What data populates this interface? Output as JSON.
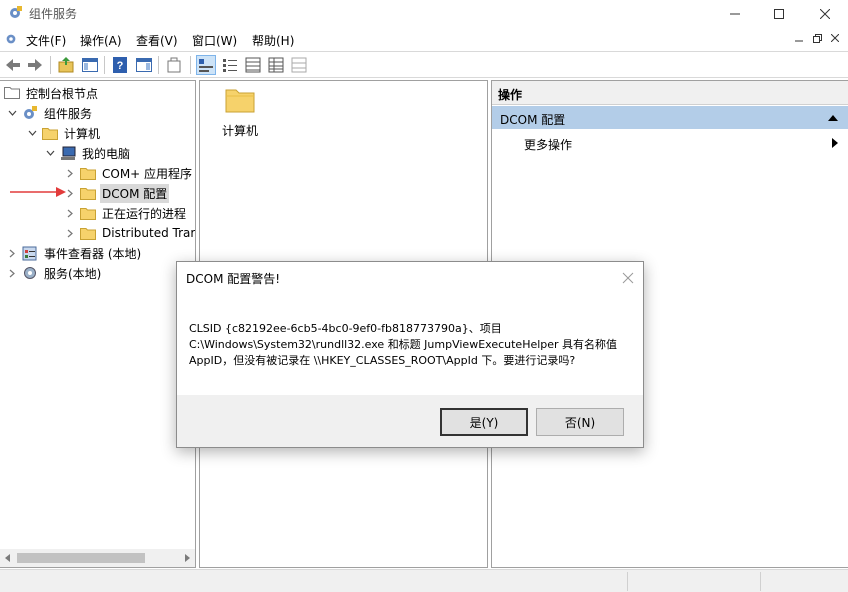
{
  "window": {
    "title": "组件服务",
    "app_icon": "component-services-icon"
  },
  "menu": [
    "文件(F)",
    "操作(A)",
    "查看(V)",
    "窗口(W)",
    "帮助(H)"
  ],
  "tree": {
    "items": [
      {
        "label": "控制台根节点",
        "icon": "folder-icon"
      },
      {
        "label": "组件服务",
        "icon": "component-services-icon"
      },
      {
        "label": "计算机",
        "icon": "folder-icon"
      },
      {
        "label": "我的电脑",
        "icon": "computer-icon"
      },
      {
        "label": "COM+ 应用程序",
        "icon": "folder-icon"
      },
      {
        "label": "DCOM 配置",
        "icon": "folder-icon"
      },
      {
        "label": "正在运行的进程",
        "icon": "folder-icon"
      },
      {
        "label": "Distributed Trar",
        "icon": "folder-icon"
      },
      {
        "label": "事件查看器 (本地)",
        "icon": "event-viewer-icon"
      },
      {
        "label": "服务(本地)",
        "icon": "services-gear-icon"
      }
    ]
  },
  "content": {
    "item_label": "计算机"
  },
  "actions": {
    "header": "操作",
    "section": "DCOM 配置",
    "more": "更多操作"
  },
  "dialog": {
    "title": "DCOM 配置警告!",
    "line1": "CLSID {c82192ee-6cb5-4bc0-9ef0-fb818773790a}、项目",
    "line2": "C:\\Windows\\System32\\rundll32.exe 和标题 JumpViewExecuteHelper 具有名称值",
    "line3": "AppID，但没有被记录在 \\\\HKEY_CLASSES_ROOT\\AppId 下。要进行记录吗?",
    "yes_label": "是(Y)",
    "no_label": "否(N)"
  },
  "colors": {
    "selection": "#d9d9d9",
    "action_section_bg": "#b3cde8",
    "folder": "#f6d26b",
    "arrow": "#e23b3b"
  }
}
